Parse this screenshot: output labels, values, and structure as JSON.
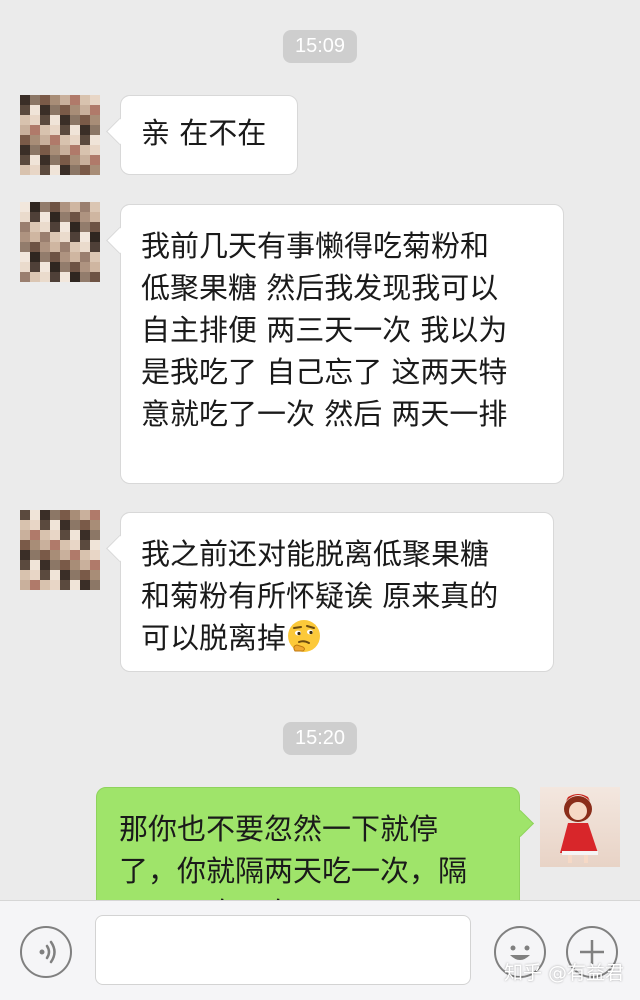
{
  "messages": {
    "time1": "15:09",
    "m1": "亲 在不在",
    "m2_lines": [
      "我前几天有事懒得吃菊粉和",
      "低聚果糖 然后我发现我可以",
      "自主排便 两三天一次 我以为",
      "是我吃了 自己忘了 这两天特",
      "意就吃了一次 然后 两天一排"
    ],
    "m3_lines": [
      "我之前还对能脱离低聚果糖",
      "和菊粉有所怀疑诶 原来真的",
      "可以脱离掉"
    ],
    "time2": "15:20",
    "m4_lines": [
      "那你也不要忽然一下就停",
      "了，你就隔两天吃一次，隔",
      "两天再吃一次"
    ]
  },
  "input": {
    "placeholder": ""
  },
  "icons": {
    "voice": "voice-icon",
    "emoji": "emoji-icon",
    "more": "plus-icon",
    "thinking": "thinking-face-emoji"
  },
  "watermark": "知乎 @有益君",
  "colors": {
    "background": "#ebebeb",
    "sent_bubble": "#9fe46a",
    "received_bubble": "#ffffff",
    "timestamp_bg": "#cecece"
  }
}
